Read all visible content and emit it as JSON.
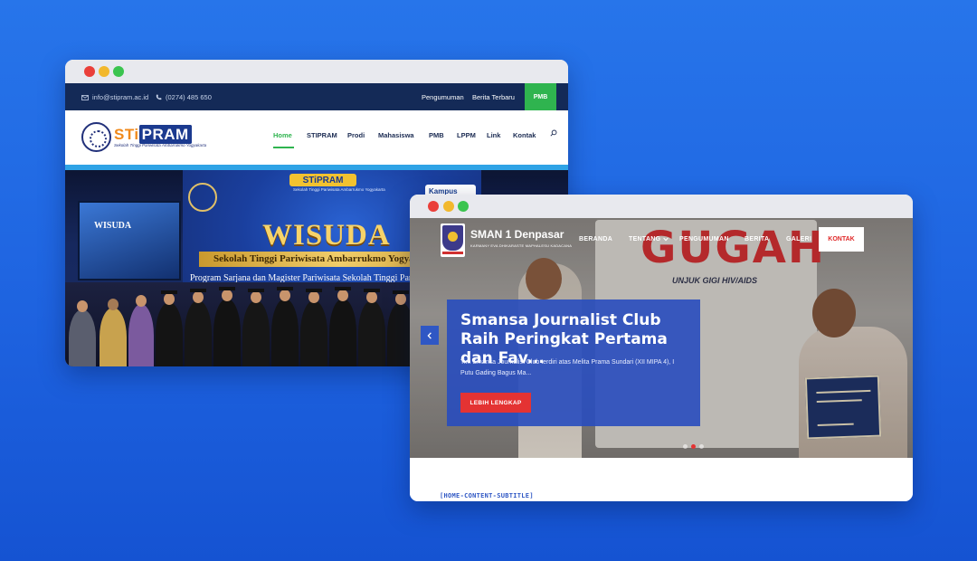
{
  "windows": {
    "stipram": {
      "topbar": {
        "email": "info@stipram.ac.id",
        "phone": "(0274) 485 650",
        "links": [
          "Pengumuman",
          "Berita Terbaru"
        ],
        "cta": "PMB"
      },
      "logo": {
        "brand_part1": "STi",
        "brand_part2": "PRAM",
        "tagline": "Sekolah Tinggi Pariwisata Ambarrukmo Yogyakarta"
      },
      "nav": [
        "Home",
        "STIPRAM",
        "Prodi",
        "Mahasiswa",
        "PMB",
        "LPPM",
        "Link",
        "Kontak"
      ],
      "active_nav": "Home",
      "hero": {
        "backdrop_logo": "STiPRAM",
        "backdrop_sub": "Sekolah Tinggi Pariwisata Ambarrukmo Yogyakarta",
        "screen_text": "WISUDA",
        "event": "WISUDA",
        "institution": "Sekolah Tinggi Pariwisata Ambarrukmo Yogyakarta",
        "program": "Program Sarjana dan Magister Pariwisata Sekolah Tinggi Pariwisata",
        "badge": "Kampus Merdeka"
      },
      "colors": {
        "topbar": "#142a57",
        "accent": "#2fb44f",
        "brand_orange": "#f08a1c"
      }
    },
    "sman": {
      "school_name": "SMAN 1 Denpasar",
      "tagline": "KARMANY EVA DHIKARASTE MAPHALESU KADACANA",
      "nav": [
        "BERANDA",
        "TENTANG",
        "PENGUMUMAN",
        "BERITA",
        "GALERI"
      ],
      "cta": "KONTAK",
      "slide": {
        "title": "Smansa Journalist Club Raih Peringkat Pertama dan Fav...",
        "description": "Tim Smansa Journalist Club terdiri atas Melita Prama Sundari (XII MIPA 4), I Putu Gading Bagus Ma...",
        "button": "LEBIH LENGKAP"
      },
      "hero_text": {
        "graffiti": "GUGAH",
        "banner": "UNJUK GIGI HIV/AIDS"
      },
      "slider_dots": 3,
      "active_dot": 1,
      "content_subtitle": "[HOME-CONTENT-SUBTITLE]",
      "colors": {
        "card": "#2f57c4",
        "button": "#e43333",
        "accent": "#2f57c4"
      }
    }
  },
  "icons": {
    "mail": "mail-icon",
    "phone": "phone-icon",
    "search": "search-icon",
    "chevron": "chevron-down-icon",
    "arrow": "chevron-left-icon"
  }
}
